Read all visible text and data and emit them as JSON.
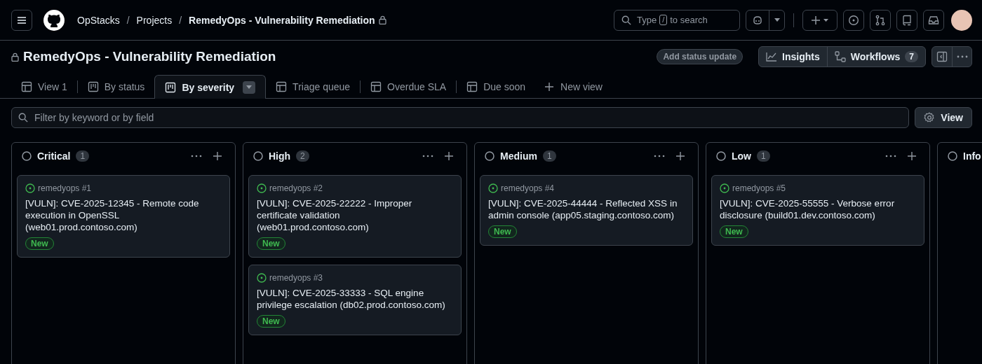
{
  "header": {
    "separator": "/",
    "breadcrumbs": [
      {
        "label": "OpStacks",
        "locked": false
      },
      {
        "label": "Projects",
        "locked": false
      },
      {
        "label": "RemedyOps - Vulnerability Remediation",
        "locked": true
      }
    ],
    "search": {
      "before": "Type",
      "key": "/",
      "after": "to search"
    }
  },
  "project": {
    "title": "RemedyOps - Vulnerability Remediation",
    "locked": true,
    "status_button": "Add status update",
    "insights": "Insights",
    "workflows": "Workflows",
    "workflows_count": "7"
  },
  "tabs": [
    {
      "label": "View 1",
      "kind": "table",
      "selected": false
    },
    {
      "label": "By status",
      "kind": "board",
      "selected": false
    },
    {
      "label": "By severity",
      "kind": "board",
      "selected": true
    },
    {
      "label": "Triage queue",
      "kind": "table",
      "selected": false
    },
    {
      "label": "Overdue SLA",
      "kind": "table",
      "selected": false
    },
    {
      "label": "Due soon",
      "kind": "table",
      "selected": false
    }
  ],
  "new_view": "New view",
  "filter": {
    "placeholder": "Filter by keyword or by field"
  },
  "view_button": "View",
  "columns": [
    {
      "name": "Critical",
      "count": "1",
      "cards": [
        {
          "repo": "remedyops #1",
          "title": "[VULN]: CVE-2025-12345 - Remote code execution in OpenSSL (web01.prod.contoso.com)",
          "label": "New"
        }
      ]
    },
    {
      "name": "High",
      "count": "2",
      "cards": [
        {
          "repo": "remedyops #2",
          "title": "[VULN]: CVE-2025-22222 - Improper certificate validation (web01.prod.contoso.com)",
          "label": "New"
        },
        {
          "repo": "remedyops #3",
          "title": "[VULN]: CVE-2025-33333 - SQL engine privilege escalation (db02.prod.contoso.com)",
          "label": "New"
        }
      ]
    },
    {
      "name": "Medium",
      "count": "1",
      "cards": [
        {
          "repo": "remedyops #4",
          "title": "[VULN]: CVE-2025-44444 - Reflected XSS in admin console (app05.staging.contoso.com)",
          "label": "New"
        }
      ]
    },
    {
      "name": "Low",
      "count": "1",
      "cards": [
        {
          "repo": "remedyops #5",
          "title": "[VULN]: CVE-2025-55555 - Verbose error disclosure (build01.dev.contoso.com)",
          "label": "New"
        }
      ]
    },
    {
      "name": "Info"
    }
  ]
}
